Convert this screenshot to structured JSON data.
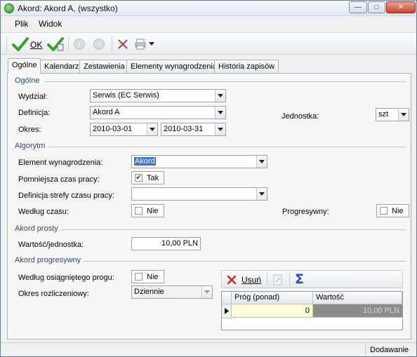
{
  "window": {
    "title": "Akord: Akord A, (wszystko)"
  },
  "menu": {
    "file": "Plik",
    "view": "Widok"
  },
  "toolbar": {
    "ok_label": "OK",
    "delete_label": "Usuń"
  },
  "tabs": [
    {
      "label": "Ogólne"
    },
    {
      "label": "Kalendarz"
    },
    {
      "label": "Zestawienia"
    },
    {
      "label": "Elementy wynagrodzenia"
    },
    {
      "label": "Historia zapisów"
    }
  ],
  "general": {
    "title": "Ogólne",
    "department_label": "Wydział:",
    "department_value": "Serwis (EC Serwis)",
    "definition_label": "Definicja:",
    "definition_value": "Akord A",
    "period_label": "Okres:",
    "period_from": "2010-03-01",
    "period_to": "2010-03-31",
    "unit_label": "Jednostka:",
    "unit_value": "szt"
  },
  "algorithm": {
    "title": "Algorytm",
    "element_label": "Element wynagrodzenia:",
    "element_value": "Akord",
    "reduces_label": "Pomniejsza czas pracy:",
    "reduces_value": "Tak",
    "reduces_checked": true,
    "zone_label": "Definicja strefy czasu pracy:",
    "zone_value": "",
    "by_time_label": "Według czasu:",
    "by_time_value": "Nie",
    "progressive_label": "Progresywny:",
    "progressive_value": "Nie"
  },
  "simple": {
    "title": "Akord prosty",
    "rate_label": "Wartość/jednostka:",
    "rate_value": "10,00 PLN"
  },
  "progressive": {
    "title": "Akord progresywny",
    "threshold_label": "Według osiągniętego progu:",
    "threshold_value": "Nie",
    "period_label": "Okres rozliczeniowy:",
    "period_value": "Dziennie",
    "grid": {
      "columns": [
        "Próg (ponad)",
        "Wartość"
      ],
      "rows": [
        {
          "threshold": "0",
          "value": "10,00 PLN"
        }
      ]
    }
  },
  "status": {
    "mode": "Dodawanie"
  },
  "colors": {
    "accent": "#2c4a78",
    "selection": "#3a76c8",
    "ok_green": "#3aa02e"
  }
}
